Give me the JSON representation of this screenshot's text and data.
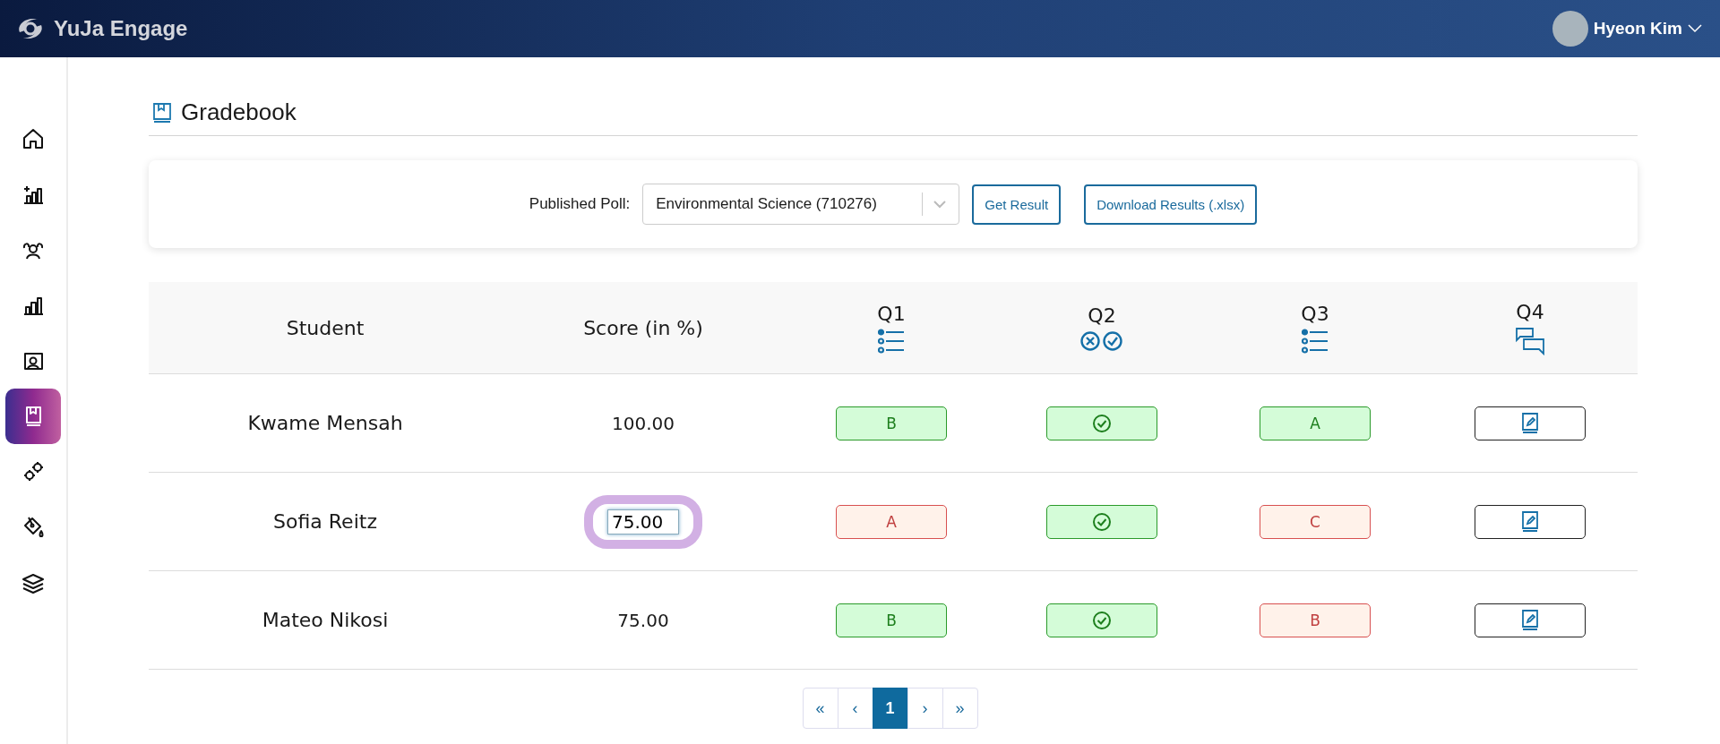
{
  "header": {
    "brand": "YuJa Engage",
    "user": "Hyeon Kim"
  },
  "sidebar": {
    "items": [
      {
        "selected": false
      },
      {
        "selected": false
      },
      {
        "selected": false
      },
      {
        "selected": false
      },
      {
        "selected": false
      },
      {
        "selected": true
      },
      {
        "selected": false
      },
      {
        "selected": false
      },
      {
        "selected": false
      }
    ]
  },
  "page": {
    "title": "Gradebook"
  },
  "filter": {
    "label": "Published Poll:",
    "value": "Environmental Science (710276)",
    "buttons": [
      "Get Result",
      "Download Results (.xlsx)"
    ]
  },
  "table": {
    "columns": [
      {
        "label": "Student",
        "kind": "text"
      },
      {
        "label": "Score (in %)",
        "kind": "text"
      },
      {
        "label": "Q1",
        "kind": "multiple-choice"
      },
      {
        "label": "Q2",
        "kind": "true-false"
      },
      {
        "label": "Q3",
        "kind": "multiple-choice"
      },
      {
        "label": "Q4",
        "kind": "short-answer"
      }
    ],
    "rows": [
      {
        "student": "Kwame Mensah",
        "score": "100.00",
        "editing": false,
        "answers": [
          {
            "kind": "letter",
            "text": "B",
            "correct": true
          },
          {
            "kind": "check",
            "correct": true
          },
          {
            "kind": "letter",
            "text": "A",
            "correct": true
          },
          {
            "kind": "open"
          }
        ]
      },
      {
        "student": "Sofia Reitz",
        "score": "75.00",
        "editing": true,
        "answers": [
          {
            "kind": "letter",
            "text": "A",
            "correct": false
          },
          {
            "kind": "check",
            "correct": true
          },
          {
            "kind": "letter",
            "text": "C",
            "correct": false
          },
          {
            "kind": "open"
          }
        ]
      },
      {
        "student": "Mateo Nikosi",
        "score": "75.00",
        "editing": false,
        "answers": [
          {
            "kind": "letter",
            "text": "B",
            "correct": true
          },
          {
            "kind": "check",
            "correct": true
          },
          {
            "kind": "letter",
            "text": "B",
            "correct": false
          },
          {
            "kind": "open"
          }
        ]
      }
    ]
  },
  "pagination": [
    {
      "label": "«",
      "selected": false
    },
    {
      "label": "‹",
      "selected": false
    },
    {
      "label": "1",
      "selected": true
    },
    {
      "label": "›",
      "selected": false
    },
    {
      "label": "»",
      "selected": false
    }
  ]
}
